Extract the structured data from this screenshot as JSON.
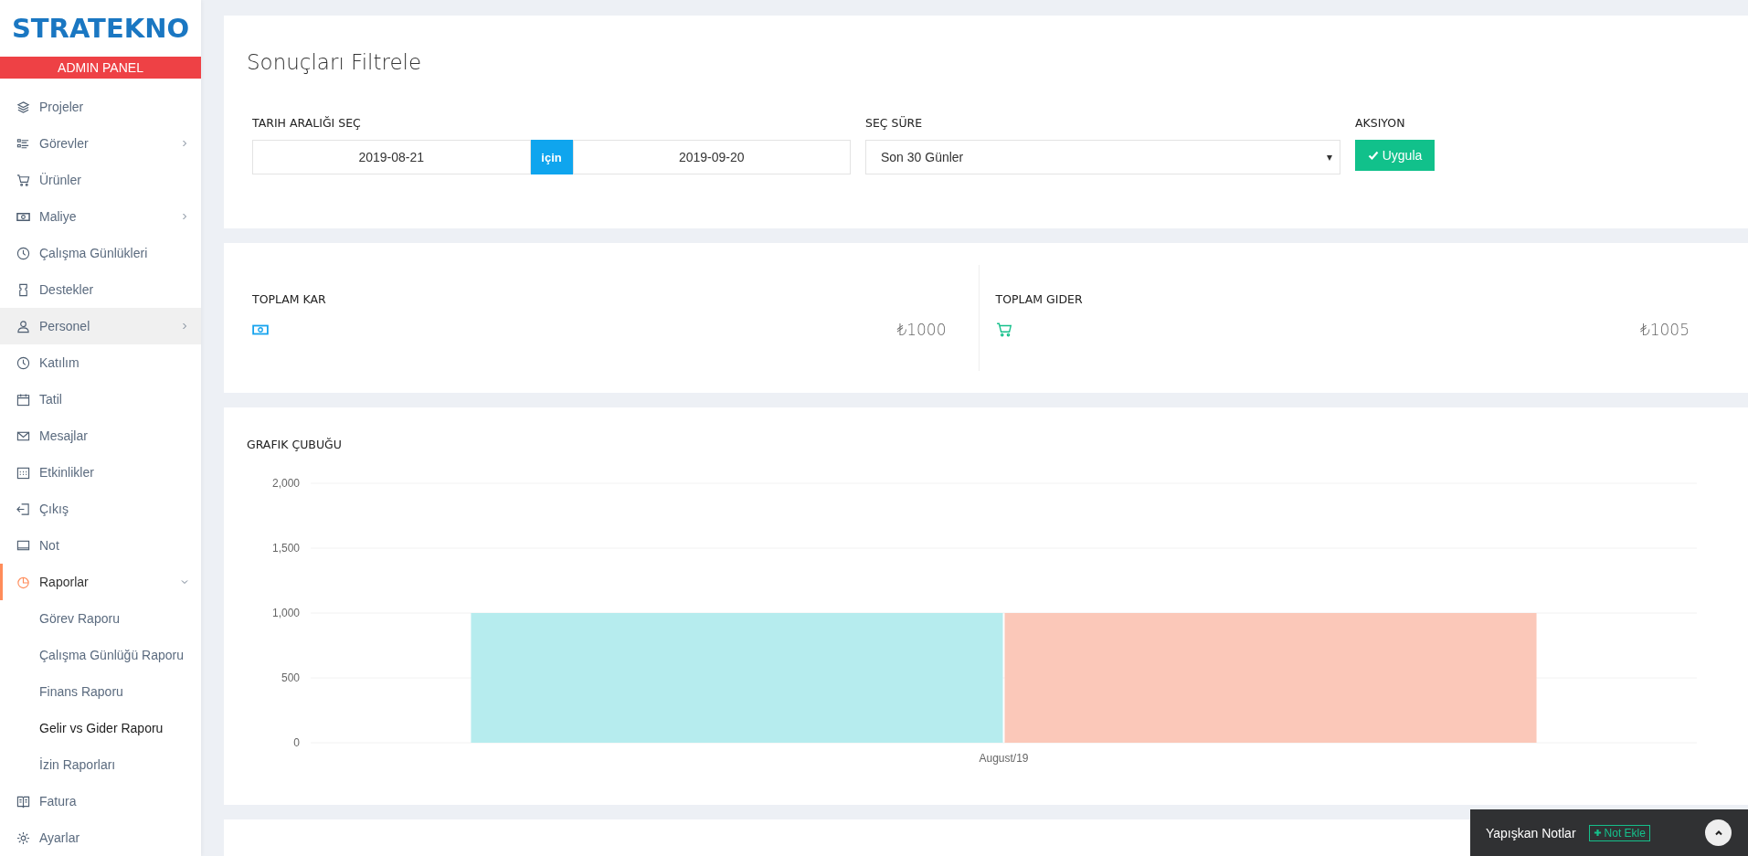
{
  "sidebar": {
    "logo": "STRATEKNO",
    "badge": "ADMIN PANEL",
    "items": [
      {
        "label": "Projeler",
        "kind": "layers",
        "selected": false,
        "hovered": false
      },
      {
        "label": "Görevler",
        "kind": "list",
        "expanded": false,
        "selected": false,
        "hovered": false
      },
      {
        "label": "Ürünler",
        "kind": "cart",
        "selected": false,
        "hovered": false
      },
      {
        "label": "Maliye",
        "kind": "money",
        "expanded": false,
        "selected": false,
        "hovered": false
      },
      {
        "label": "Çalışma Günlükleri",
        "kind": "clock",
        "selected": false,
        "hovered": false
      },
      {
        "label": "Destekler",
        "kind": "ticket",
        "selected": false,
        "hovered": false
      },
      {
        "label": "Personel",
        "kind": "user",
        "expanded": false,
        "selected": false,
        "hovered": true
      },
      {
        "label": "Katılım",
        "kind": "clock",
        "selected": false,
        "hovered": false
      },
      {
        "label": "Tatil",
        "kind": "calendar",
        "selected": false,
        "hovered": false
      },
      {
        "label": "Mesajlar",
        "kind": "mail",
        "selected": false,
        "hovered": false
      },
      {
        "label": "Etkinlikler",
        "kind": "grid",
        "selected": false,
        "hovered": false
      },
      {
        "label": "Çıkış",
        "kind": "logout",
        "selected": false,
        "hovered": false
      },
      {
        "label": "Not",
        "kind": "laptop",
        "selected": false,
        "hovered": false
      },
      {
        "label": "Raporlar",
        "kind": "pie",
        "expanded": true,
        "selected": true,
        "hovered": false,
        "children": [
          {
            "label": "Görev Raporu",
            "selected": false
          },
          {
            "label": "Çalışma Günlüğü Raporu",
            "selected": false
          },
          {
            "label": "Finans Raporu",
            "selected": false
          },
          {
            "label": "Gelir vs Gider Raporu",
            "selected": true
          },
          {
            "label": "İzin Raporları",
            "selected": false
          }
        ]
      },
      {
        "label": "Fatura",
        "kind": "book",
        "selected": false,
        "hovered": false
      },
      {
        "label": "Ayarlar",
        "kind": "gear",
        "selected": false,
        "hovered": false
      }
    ]
  },
  "filter": {
    "title": "Sonuçları Filtrele",
    "date_range_label": "TARIH ARALIĞI SEÇ",
    "start_date": "2019-08-21",
    "separator": "için",
    "end_date": "2019-09-20",
    "period_label": "SEÇ SÜRE",
    "period_value": "Son 30 Günler",
    "dropdown_arrow": "▾",
    "action_label": "AKSIYON",
    "apply_button": "Uygula"
  },
  "summary": [
    {
      "label": "TOPLAM KAR",
      "kind": "money",
      "value": "₺1000"
    },
    {
      "label": "TOPLAM GIDER",
      "kind": "cart",
      "value": "₺1005"
    }
  ],
  "chart_panel": {
    "title": "GRAFIK ÇUBUĞU",
    "chart_data": {
      "type": "bar",
      "grid": true,
      "categories": [
        "August/19"
      ],
      "series": [
        {
          "color": "#b6ecee",
          "values": [
            1000
          ]
        },
        {
          "color": "#fbc8b9",
          "values": [
            1000
          ]
        }
      ],
      "ylim": [
        0,
        2000
      ],
      "yticks": [
        {
          "value": 0,
          "label": "0"
        },
        {
          "value": 500,
          "label": "500"
        },
        {
          "value": 1000,
          "label": "1,000"
        },
        {
          "value": 1500,
          "label": "1,500"
        },
        {
          "value": 2000,
          "label": "2,000"
        }
      ]
    }
  },
  "sticky_notes": {
    "title": "Yapışkan Notlar",
    "add_button": "Not Ekle"
  }
}
